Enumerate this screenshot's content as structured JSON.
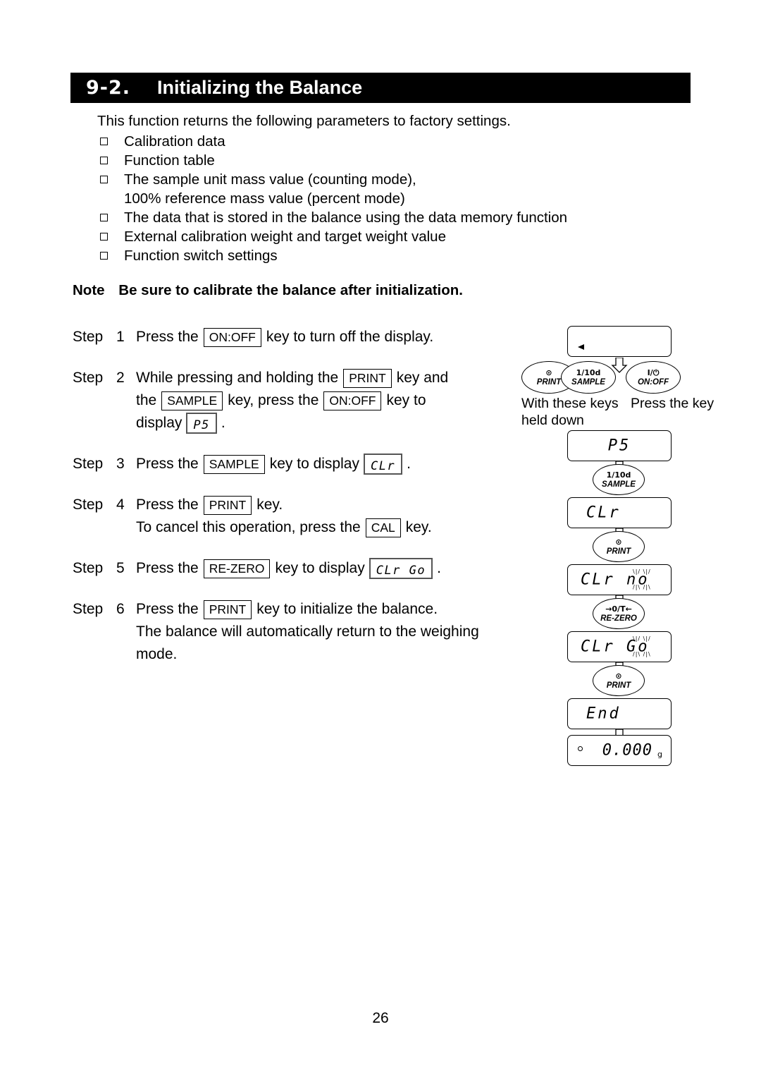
{
  "heading": {
    "number": "9‑2.",
    "title": "Initializing the Balance"
  },
  "intro": "This function returns the following parameters to factory settings.",
  "bullets": [
    {
      "text": "Calibration data"
    },
    {
      "text": "Function table"
    },
    {
      "text": "The sample unit mass value (counting mode),",
      "continuation": "100% reference mass value (percent mode)"
    },
    {
      "text": "The data that is stored in the balance using the data memory function"
    },
    {
      "text": "External calibration weight and target weight value"
    },
    {
      "text": "Function switch settings"
    }
  ],
  "note": {
    "label": "Note",
    "text": "Be sure to calibrate the balance after initialization."
  },
  "steps": [
    {
      "word": "Step",
      "num": "1",
      "lines": [
        {
          "parts": [
            {
              "type": "text",
              "value": "Press the"
            },
            {
              "type": "key",
              "value": "ON:OFF"
            },
            {
              "type": "text",
              "value": "key to turn off the display."
            }
          ]
        }
      ]
    },
    {
      "word": "Step",
      "num": "2",
      "lines": [
        {
          "parts": [
            {
              "type": "text",
              "value": "While pressing and holding the"
            },
            {
              "type": "key",
              "value": "PRINT"
            },
            {
              "type": "text",
              "value": "key and"
            }
          ]
        },
        {
          "parts": [
            {
              "type": "text",
              "value": "the"
            },
            {
              "type": "key",
              "value": "SAMPLE"
            },
            {
              "type": "text",
              "value": "key, press the"
            },
            {
              "type": "key",
              "value": "ON:OFF"
            },
            {
              "type": "text",
              "value": "key to"
            }
          ]
        },
        {
          "parts": [
            {
              "type": "text",
              "value": "display"
            },
            {
              "type": "seg",
              "value": "P5"
            },
            {
              "type": "text",
              "value": "."
            }
          ]
        }
      ]
    },
    {
      "word": "Step",
      "num": "3",
      "lines": [
        {
          "parts": [
            {
              "type": "text",
              "value": "Press the"
            },
            {
              "type": "key",
              "value": "SAMPLE"
            },
            {
              "type": "text",
              "value": "key to display"
            },
            {
              "type": "seg",
              "value": "CLr"
            },
            {
              "type": "text",
              "value": "."
            }
          ]
        }
      ]
    },
    {
      "word": "Step",
      "num": "4",
      "lines": [
        {
          "parts": [
            {
              "type": "text",
              "value": "Press the"
            },
            {
              "type": "key",
              "value": "PRINT"
            },
            {
              "type": "text",
              "value": "key."
            }
          ]
        },
        {
          "parts": [
            {
              "type": "text",
              "value": "To cancel this operation, press the"
            },
            {
              "type": "key",
              "value": "CAL"
            },
            {
              "type": "text",
              "value": "key."
            }
          ]
        }
      ]
    },
    {
      "word": "Step",
      "num": "5",
      "lines": [
        {
          "parts": [
            {
              "type": "text",
              "value": "Press the"
            },
            {
              "type": "key",
              "value": "RE-ZERO"
            },
            {
              "type": "text",
              "value": "key to display"
            },
            {
              "type": "seg",
              "value": "CLr Go"
            },
            {
              "type": "text",
              "value": "."
            }
          ]
        }
      ]
    },
    {
      "word": "Step",
      "num": "6",
      "lines": [
        {
          "parts": [
            {
              "type": "text",
              "value": "Press the"
            },
            {
              "type": "key",
              "value": "PRINT"
            },
            {
              "type": "text",
              "value": "key to initialize the balance."
            }
          ]
        },
        {
          "parts": [
            {
              "type": "text",
              "value": "The balance will automatically return to the weighing"
            }
          ]
        },
        {
          "parts": [
            {
              "type": "text",
              "value": "mode."
            }
          ]
        }
      ]
    }
  ],
  "flow": {
    "captions": {
      "with_keys_line1": "With these keys",
      "with_keys_line2": "held down",
      "press_key": "Press the key"
    },
    "keys": {
      "print": {
        "icon": "⊙",
        "label": "PRINT",
        "icon_name": "print-circle-dot-icon"
      },
      "sample": {
        "icon": "1/10d",
        "label": "SAMPLE",
        "icon_name": "sample-tenth-d-icon"
      },
      "onoff": {
        "icon": "I/⏻",
        "label": "ON:OFF",
        "icon_name": "power-icon"
      },
      "rezero": {
        "icon": "→0/T←",
        "label": "RE-ZERO",
        "icon_name": "re-zero-arrows-icon"
      }
    },
    "displays": [
      {
        "id": "display-blank",
        "value": "",
        "marker": "triangle"
      },
      {
        "id": "display-p5",
        "value": "P5"
      },
      {
        "id": "display-clr",
        "value": "CLr"
      },
      {
        "id": "display-clr-no",
        "value": "CLr no",
        "blink": true
      },
      {
        "id": "display-clr-go",
        "value": "CLr Go",
        "blink": true
      },
      {
        "id": "display-end",
        "value": "End"
      },
      {
        "id": "display-weighing",
        "value": "0.000",
        "unit": "g",
        "stable": true
      }
    ]
  },
  "page_number": "26"
}
